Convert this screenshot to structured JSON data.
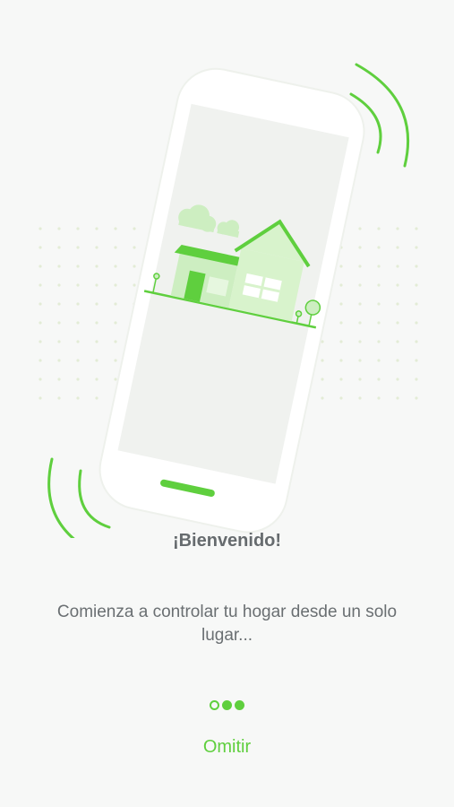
{
  "welcome": {
    "title": "¡Bienvenido!",
    "subtitle": "Comienza a controlar tu hogar desde un solo lugar..."
  },
  "pager": {
    "total": 3,
    "current": 1
  },
  "actions": {
    "skip_label": "Omitir"
  },
  "colors": {
    "accent": "#5fcf3e",
    "accent_light": "#d8f3cc",
    "text": "#666b6e"
  },
  "icons": [
    "phone-illustration",
    "house-icon",
    "signal-wave-icon",
    "cloud-icon",
    "tree-icon"
  ]
}
